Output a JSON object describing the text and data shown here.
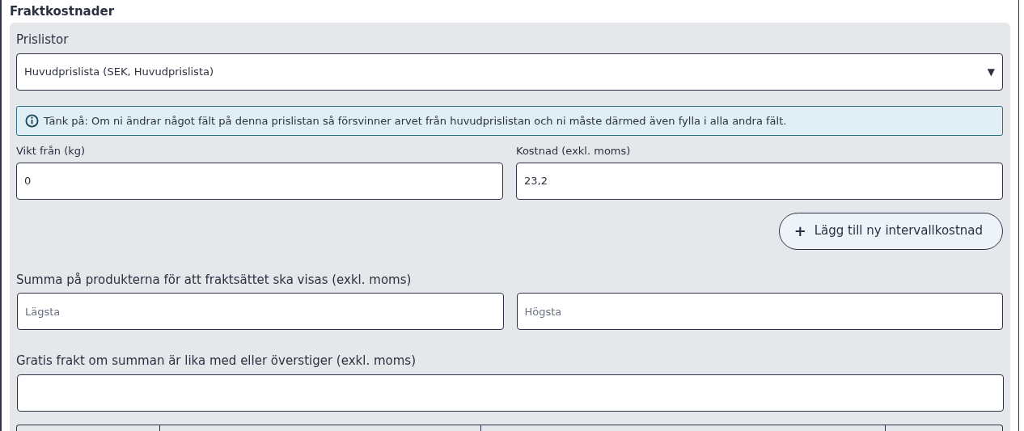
{
  "section_title": "Fraktkostnader",
  "pricelist": {
    "label": "Prislistor",
    "value": "Huvudprislista (SEK, Huvudprislista)",
    "caret": "▼"
  },
  "notice": {
    "text": "Tänk på: Om ni ändrar något fält på denna prislistan så försvinner arvet från huvudprislistan och ni måste därmed även fylla i alla andra fält."
  },
  "intervals": [
    {
      "weight_label": "Vikt från (kg)",
      "weight_value": "0",
      "cost_label": "Kostnad (exkl. moms)",
      "cost_value": "23,2"
    }
  ],
  "add_button": {
    "icon": "+",
    "label": "Lägg till ny intervallkostnad"
  },
  "sum_range": {
    "label": "Summa på produkterna för att fraktsättet ska visas (exkl. moms)",
    "min_placeholder": "Lägsta",
    "max_placeholder": "Högsta"
  },
  "free_shipping": {
    "label": "Gratis frakt om summan är lika med eller överstiger (exkl. moms)"
  }
}
